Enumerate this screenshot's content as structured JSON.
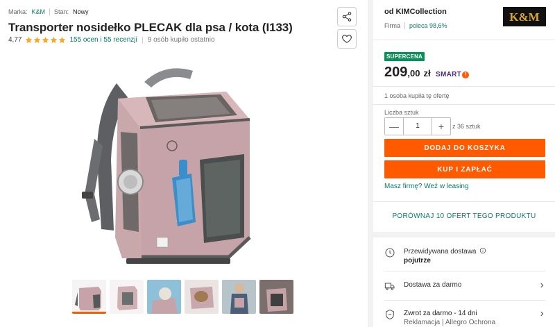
{
  "product": {
    "brand_label": "Marka:",
    "brand_value": "K&M",
    "condition_label": "Stan:",
    "condition_value": "Nowy",
    "title": "Transporter nosidełko PLECAK dla psa / kota (I133)",
    "rating": "4,77",
    "rating_link": "155 ocen i 55 recenzji",
    "recently_bought": "9 osób kupiło ostatnio",
    "stars": 5,
    "thumbnail_count": 6
  },
  "seller": {
    "name": "od KIMCollection",
    "type": "Firma",
    "recommend": "poleca 98,6%",
    "logo_text": "K&M"
  },
  "offer": {
    "badge": "SUPERCENA",
    "price_int": "209",
    "price_dec": ",00",
    "currency": "zł",
    "smart_label": "SMART",
    "smart_mark": "!",
    "bought_one": "1 osoba kupiła tę ofertę",
    "qty_label": "Liczba sztuk",
    "qty_value": "1",
    "qty_minus": "—",
    "qty_plus": "+",
    "qty_max": "z 36 sztuk",
    "add_to_cart": "DODAJ DO KOSZYKA",
    "buy_now": "KUP I ZAPŁAĆ",
    "leasing": "Masz firmę? Weź w leasing",
    "compare": "PORÓWNAJ 10 OFERT TEGO PRODUKTU"
  },
  "delivery": {
    "expected_label": "Przewidywana dostawa",
    "expected_value": "pojutrze",
    "free_delivery": "Dostawa za darmo",
    "return_label": "Zwrot za darmo - 14 dni",
    "return_sub": "Reklamacja | Allegro Ochrona"
  },
  "colors": {
    "accent": "#ff5a00",
    "link": "#0a7a66",
    "badge": "#0a8f5a",
    "star": "#f5a623"
  }
}
